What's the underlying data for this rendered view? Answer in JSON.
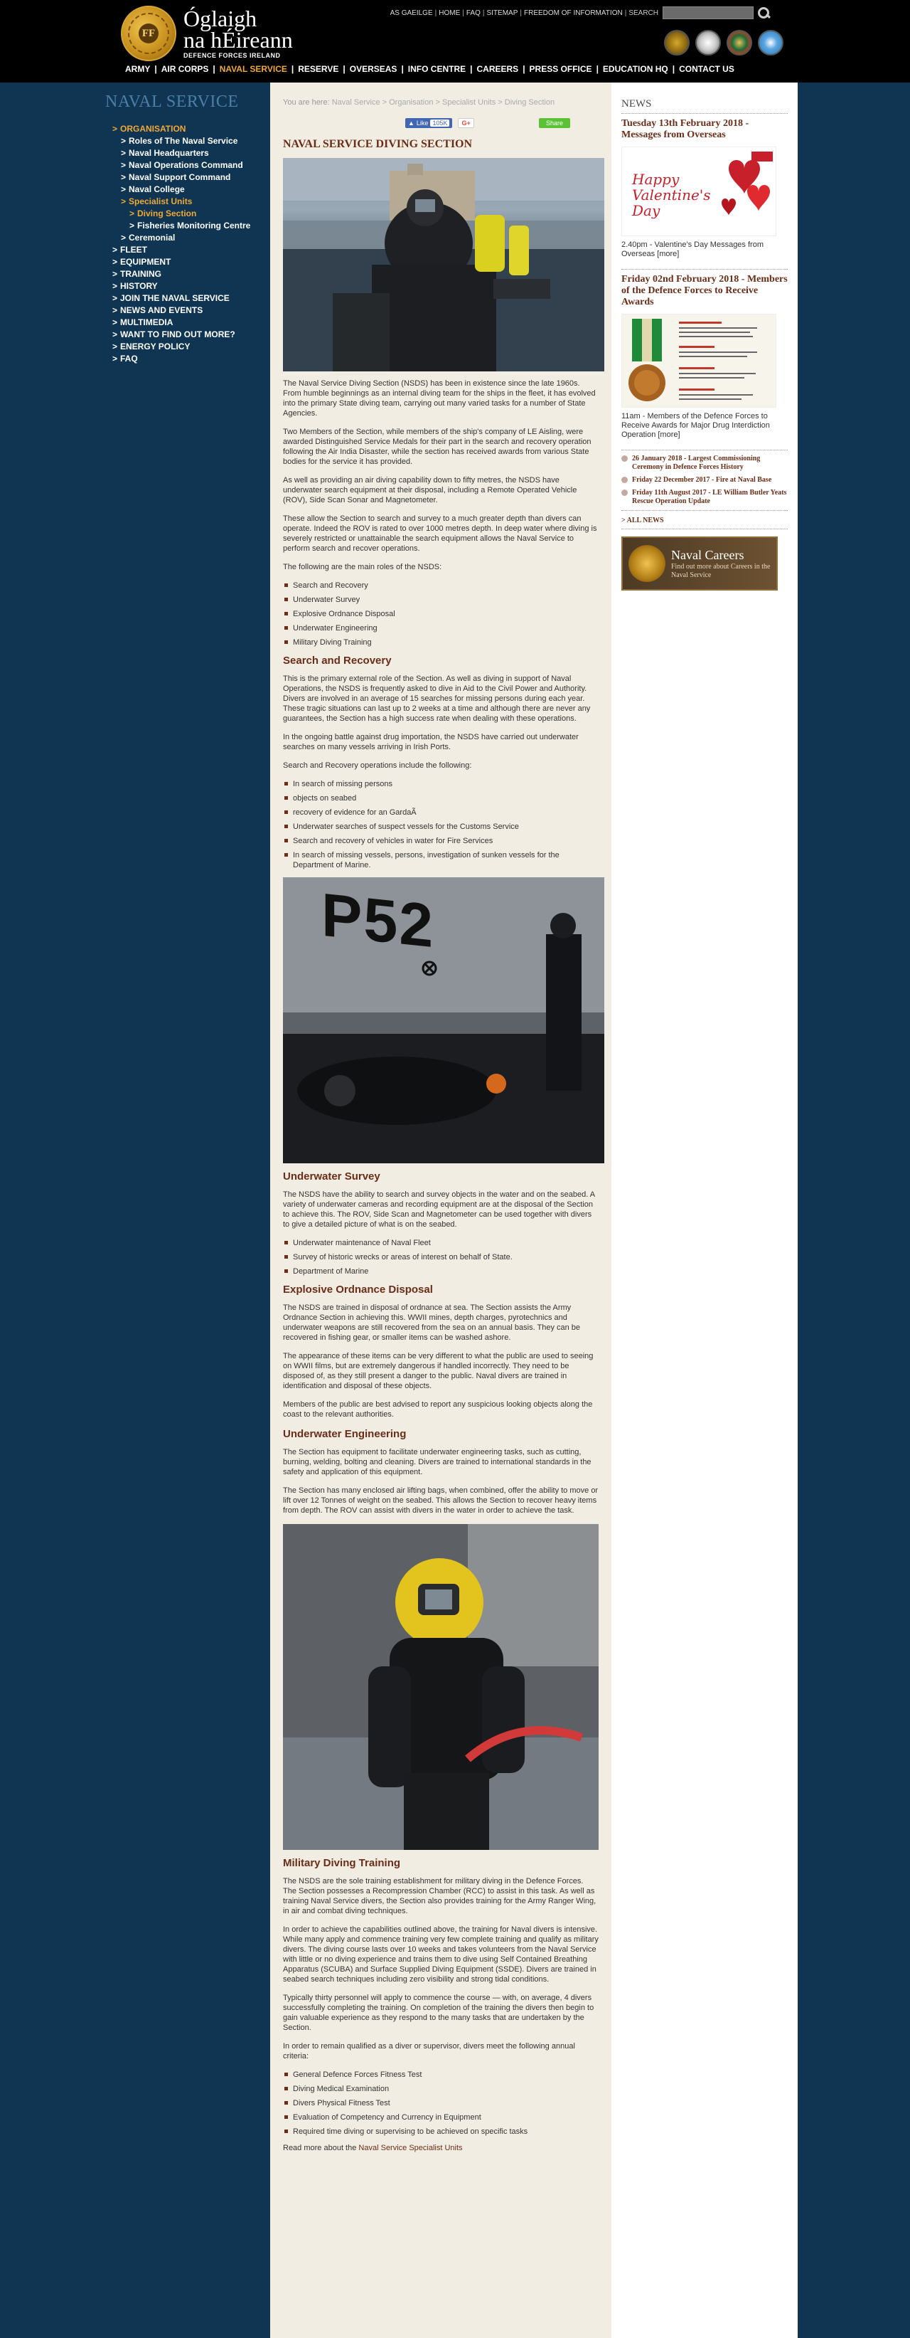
{
  "header": {
    "logo_line1": "Óglaigh",
    "logo_line2": "na hÉireann",
    "logo_line3": "DEFENCE FORCES IRELAND",
    "crest_letters": "FF",
    "util": [
      "AS GAEILGE",
      "HOME",
      "FAQ",
      "SITEMAP",
      "FREEDOM OF INFORMATION",
      "SEARCH"
    ],
    "search_placeholder": "",
    "nav": [
      "ARMY",
      "AIR CORPS",
      "NAVAL SERVICE",
      "RESERVE",
      "OVERSEAS",
      "INFO CENTRE",
      "CAREERS",
      "PRESS OFFICE",
      "EDUCATION HQ",
      "CONTACT US"
    ],
    "nav_active_index": 2
  },
  "sidebar": {
    "title": "NAVAL SERVICE",
    "items": [
      {
        "label": "ORGANISATION",
        "level": 1,
        "active": true
      },
      {
        "label": "Roles of The Naval Service",
        "level": 2,
        "active": false
      },
      {
        "label": "Naval Headquarters",
        "level": 2,
        "active": false
      },
      {
        "label": "Naval Operations Command",
        "level": 2,
        "active": false
      },
      {
        "label": "Naval Support Command",
        "level": 2,
        "active": false
      },
      {
        "label": "Naval College",
        "level": 2,
        "active": false
      },
      {
        "label": "Specialist Units",
        "level": 2,
        "active": true
      },
      {
        "label": "Diving Section",
        "level": 3,
        "active": true
      },
      {
        "label": "Fisheries Monitoring Centre",
        "level": 3,
        "active": false
      },
      {
        "label": "Ceremonial",
        "level": 2,
        "active": false
      },
      {
        "label": "FLEET",
        "level": 1,
        "active": false
      },
      {
        "label": "EQUIPMENT",
        "level": 1,
        "active": false
      },
      {
        "label": "TRAINING",
        "level": 1,
        "active": false
      },
      {
        "label": "HISTORY",
        "level": 1,
        "active": false
      },
      {
        "label": "JOIN THE NAVAL SERVICE",
        "level": 1,
        "active": false
      },
      {
        "label": "NEWS AND EVENTS",
        "level": 1,
        "active": false
      },
      {
        "label": "MULTIMEDIA",
        "level": 1,
        "active": false
      },
      {
        "label": "WANT TO FIND OUT MORE?",
        "level": 1,
        "active": false
      },
      {
        "label": "ENERGY POLICY",
        "level": 1,
        "active": false
      },
      {
        "label": "FAQ",
        "level": 1,
        "active": false
      }
    ]
  },
  "breadcrumb": {
    "prefix": "You are here:",
    "path": "Naval Service > Organisation > Specialist Units > Diving Section"
  },
  "social": {
    "like": "Like",
    "like_count": "105K",
    "gplus": "G+",
    "share": "Share"
  },
  "main": {
    "title": "NAVAL SERVICE DIVING SECTION",
    "intro": [
      "The Naval Service Diving Section (NSDS) has been in existence since the late 1960s. From humble beginnings as an internal diving team for the ships in the fleet, it has evolved into the primary State diving team, carrying out many varied tasks for a number of State Agencies.",
      "Two Members of the Section, while members of the ship's company of LE Aisling, were awarded Distinguished Service Medals for their part in the search and recovery operation following the Air India Disaster, while the section has received awards from various State bodies for the service it has provided.",
      "As well as providing an air diving capability down to fifty metres, the NSDS have underwater search equipment at their disposal, including a Remote Operated Vehicle (ROV), Side Scan Sonar and Magnetometer.",
      "These allow the Section to search and survey to a much greater depth than divers can operate. Indeed the ROV is rated to over 1000 metres depth. In deep water where diving is severely restricted or unattainable the search equipment allows the Naval Service to perform search and recover operations.",
      "The following are the main roles of the NSDS:"
    ],
    "roles": [
      "Search and Recovery",
      "Underwater Survey",
      "Explosive Ordnance Disposal",
      "Underwater Engineering",
      "Military Diving Training"
    ],
    "sar": {
      "heading": "Search and Recovery",
      "paras": [
        "This is the primary external role of the Section. As well as diving in support of Naval Operations, the NSDS is frequently asked to dive in Aid to the Civil Power and Authority. Divers are involved in an average of 15 searches for missing persons during each year. These tragic situations can last up to 2 weeks at a time and although there are never any guarantees, the Section has a high success rate when dealing with these operations.",
        "In the ongoing battle against drug importation, the NSDS have carried out underwater searches on many vessels arriving in Irish Ports.",
        "Search and Recovery operations include the following:"
      ],
      "list": [
        "In search of missing persons",
        "objects on seabed",
        "recovery of evidence for an GardaÃ",
        "Underwater searches of suspect vessels for the Customs Service",
        "Search and recovery of vehicles in water for Fire Services",
        "In search of missing vessels, persons, investigation of sunken vessels for the Department of Marine."
      ],
      "photo_hull_text": "P52"
    },
    "survey": {
      "heading": "Underwater Survey",
      "para": "The NSDS have the ability to search and survey objects in the water and on the seabed. A variety of underwater cameras and recording equipment are at the disposal of the Section to achieve this. The ROV, Side Scan and Magnetometer can be used together with divers to give a detailed picture of what is on the seabed.",
      "list": [
        "Underwater maintenance of Naval Fleet",
        "Survey of historic wrecks or areas of interest on behalf of State.",
        "Department of Marine"
      ]
    },
    "eod": {
      "heading": "Explosive Ordnance Disposal",
      "paras": [
        "The NSDS are trained in disposal of ordnance at sea. The Section assists the Army Ordnance Section in achieving this. WWII mines, depth charges, pyrotechnics and underwater weapons are still recovered from the sea on an annual basis. They can be recovered in fishing gear, or smaller items can be washed ashore.",
        "The appearance of these items can be very different to what the public are used to seeing on WWII films, but are extremely dangerous if handled incorrectly. They need to be disposed of, as they still present a danger to the public. Naval divers are trained in identification and disposal of these objects.",
        "Members of the public are best advised to report any suspicious looking objects along the coast to the relevant authorities."
      ]
    },
    "engineering": {
      "heading": "Underwater Engineering",
      "paras": [
        "The Section has equipment to facilitate underwater engineering tasks, such as cutting, burning, welding, bolting and cleaning. Divers are trained to international standards in the safety and application of this equipment.",
        "The Section has many enclosed air lifting bags, when combined, offer the ability to move or lift over 12 Tonnes of weight on the seabed. This allows the Section to recover heavy items from depth. The ROV can assist with divers in the water in order to achieve the task."
      ]
    },
    "training": {
      "heading": "Military Diving Training",
      "paras": [
        "The NSDS are the sole training establishment for military diving in the Defence Forces. The Section possesses a Recompression Chamber (RCC) to assist in this task. As well as training Naval Service divers, the Section also provides training for the Army Ranger Wing, in air and combat diving techniques.",
        "In order to achieve the capabilities outlined above, the training for Naval divers is intensive. While many apply and commence training very few complete training and qualify as military divers. The diving course lasts over 10 weeks and takes volunteers from the Naval Service with little or no diving experience and trains them to dive using Self Contained Breathing Apparatus (SCUBA) and Surface Supplied Diving Equipment (SSDE). Divers are trained in seabed search techniques including zero visibility and strong tidal conditions.",
        "Typically thirty personnel will apply to commence the course — with, on average, 4 divers successfully completing the training. On completion of the training the divers then begin to gain valuable experience as they respond to the many tasks that are undertaken by the Section.",
        "In order to remain qualified as a diver or supervisor, divers meet the following annual criteria:"
      ],
      "list": [
        "General Defence Forces Fitness Test",
        "Diving Medical Examination",
        "Divers Physical Fitness Test",
        "Evaluation of Competency and Currency in Equipment",
        "Required time diving or supervising to be achieved on specific tasks"
      ]
    },
    "read_more_prefix": "Read more about the",
    "read_more_link": "Naval Service Specialist Units"
  },
  "news": {
    "heading": "NEWS",
    "item1": {
      "title": "Tuesday 13th February 2018 - Messages from Overseas",
      "text": "2.40pm - Valentine's Day Messages from Overseas",
      "more": "[more]",
      "img_text": "Happy Valentine's Day"
    },
    "item2": {
      "title": "Friday 02nd February 2018 - Members of the Defence Forces to Receive Awards",
      "text": "11am - Members of the Defence Forces to Receive Awards for Major Drug Interdiction Operation",
      "more": "[more]"
    },
    "list": [
      "26 January 2018 - Largest Commissioning Ceremony in Defence Forces History",
      "Friday 22 December 2017 - Fire at Naval Base",
      "Friday 11th August 2017 - LE William Butler Yeats Rescue Operation Update"
    ],
    "all_news": "> ALL NEWS",
    "careers_title": "Naval Careers",
    "careers_sub": "Find out more about Careers in the Naval Service"
  },
  "colors": {
    "accent": "#f0a836",
    "heading": "#6b2d17",
    "page_bg": "#0f3553"
  }
}
